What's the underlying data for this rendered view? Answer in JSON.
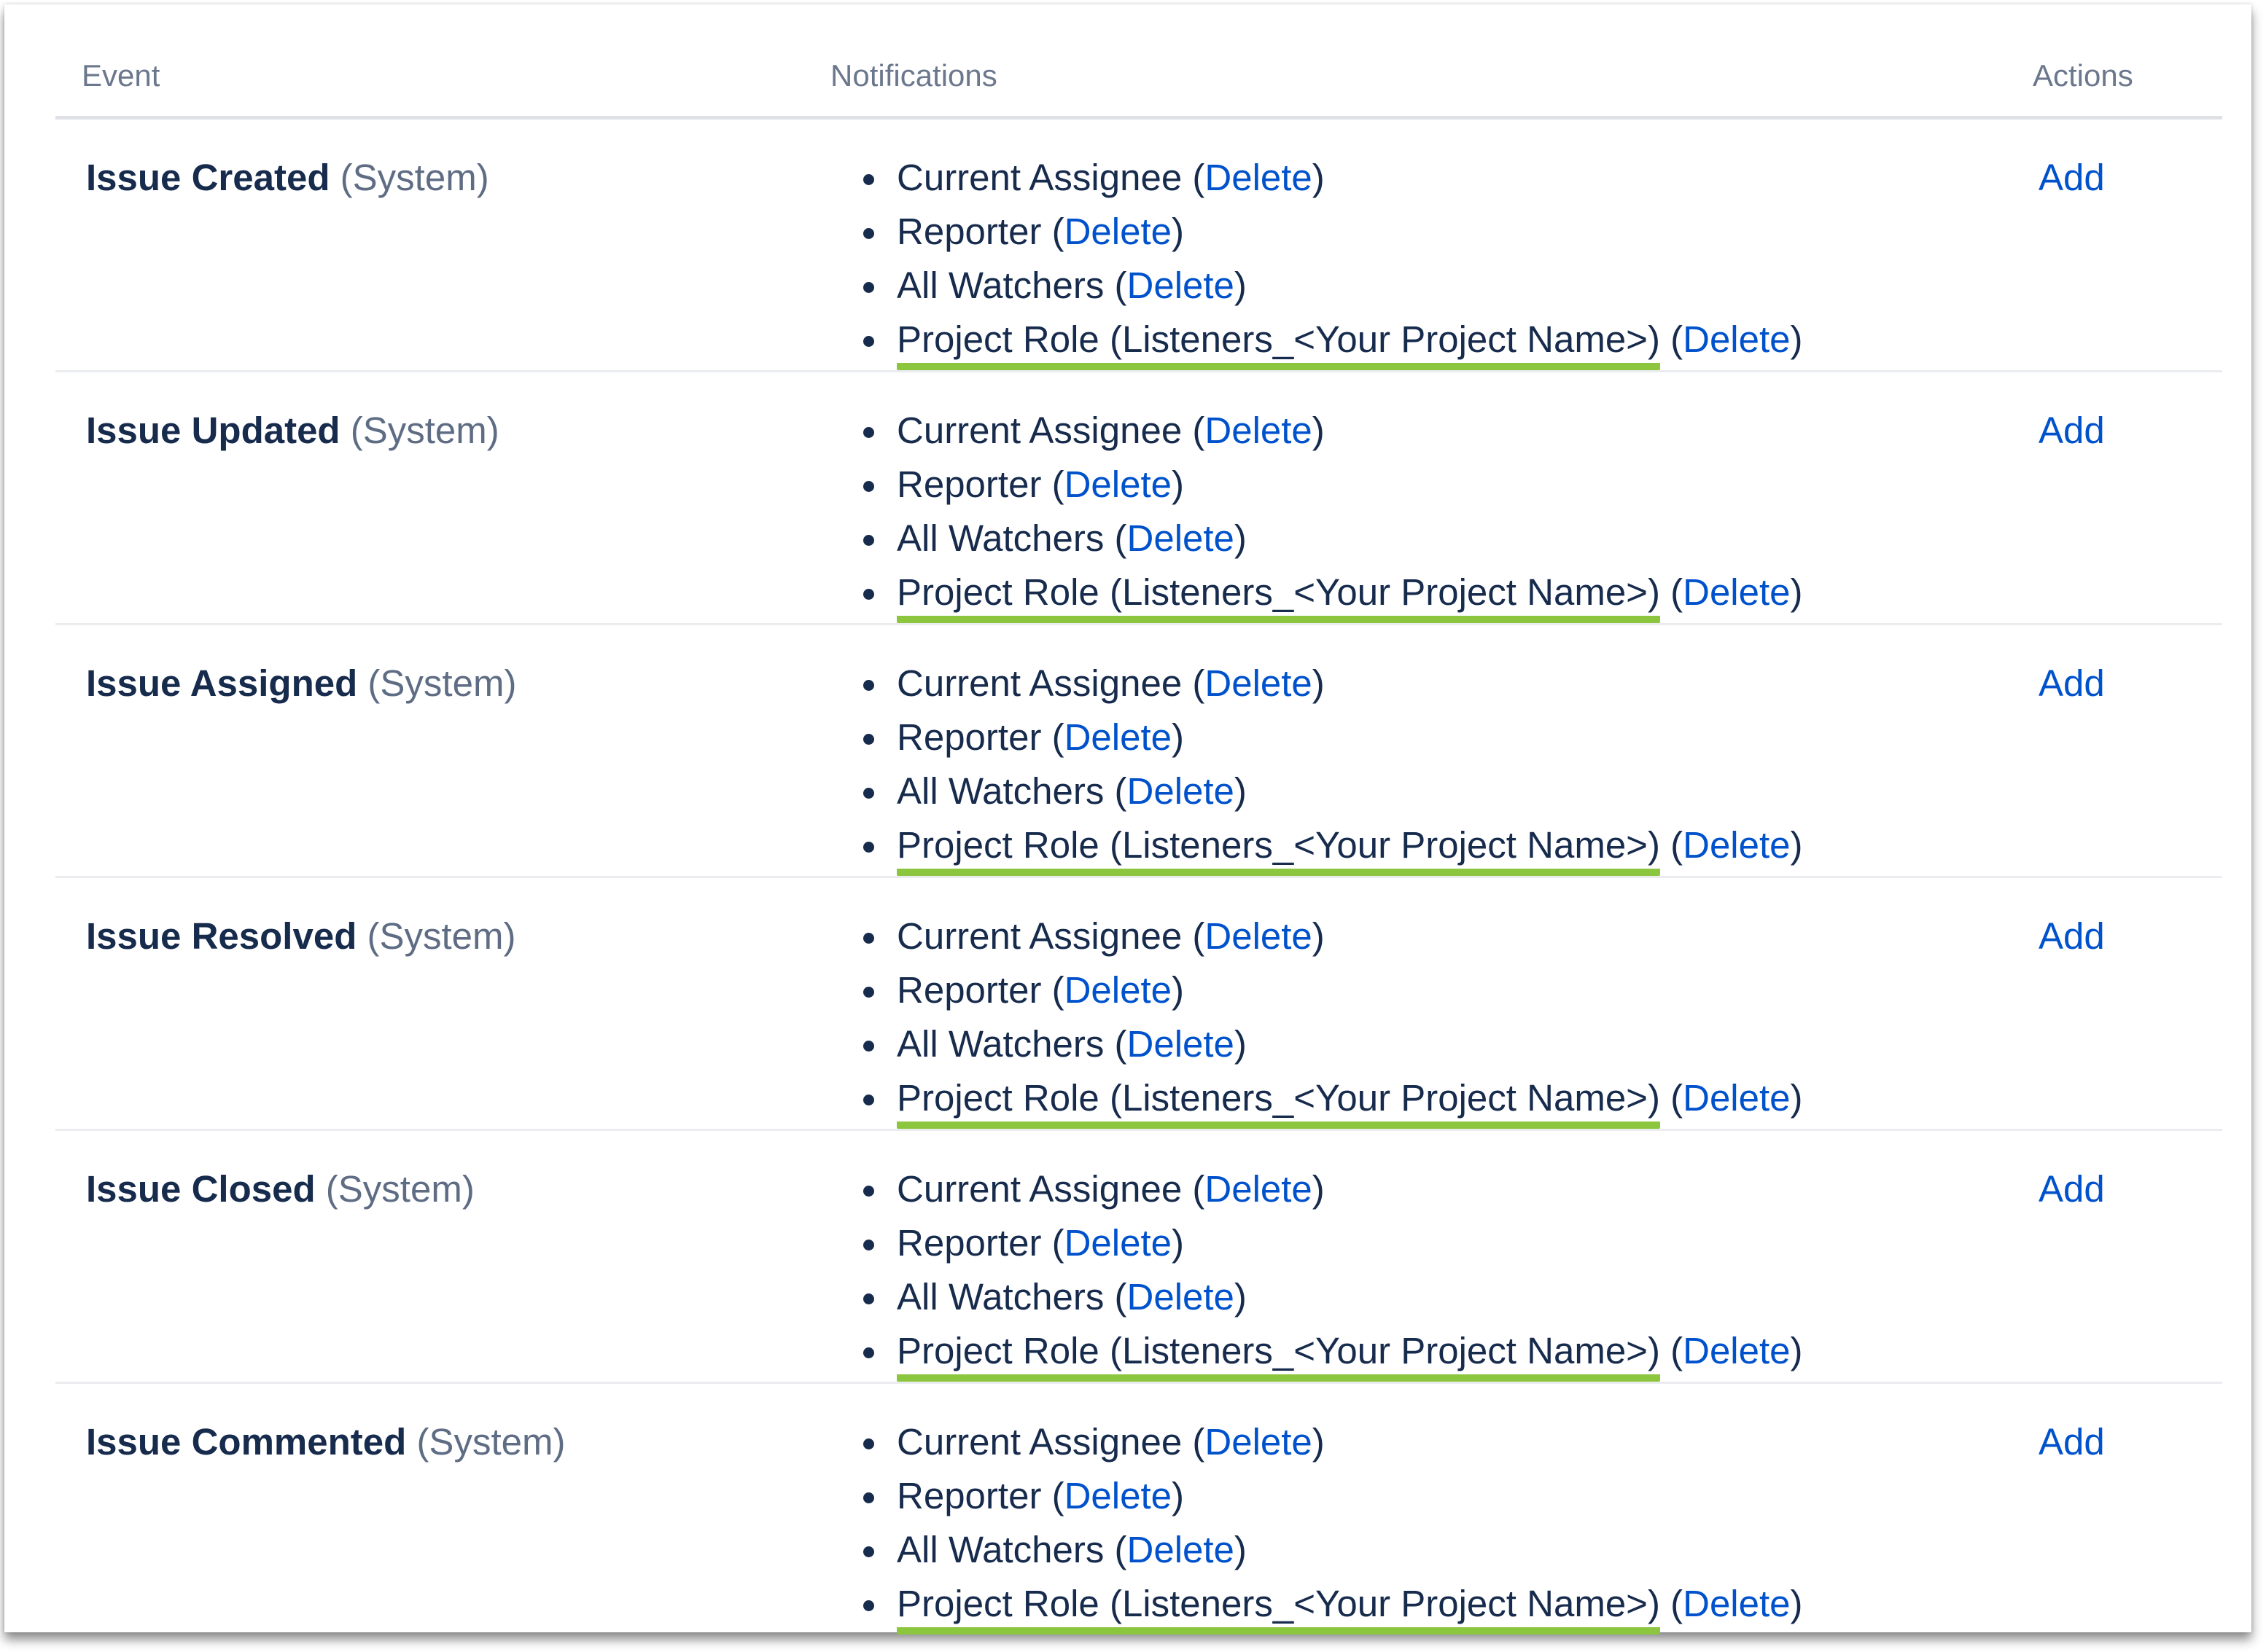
{
  "table": {
    "headers": {
      "event": "Event",
      "notifications": "Notifications",
      "actions": "Actions"
    },
    "delete_label": "Delete",
    "add_label": "Add",
    "accent_color": "#8cc63f",
    "link_color": "#0052cc",
    "rows": [
      {
        "event": "Issue Created",
        "type": "(System)",
        "notifications": [
          "Current Assignee",
          "Reporter",
          "All Watchers",
          "Project Role (Listeners_<Your Project Name>)"
        ]
      },
      {
        "event": "Issue Updated",
        "type": "(System)",
        "notifications": [
          "Current Assignee",
          "Reporter",
          "All Watchers",
          "Project Role (Listeners_<Your Project Name>)"
        ]
      },
      {
        "event": "Issue Assigned",
        "type": "(System)",
        "notifications": [
          "Current Assignee",
          "Reporter",
          "All Watchers",
          "Project Role (Listeners_<Your Project Name>)"
        ]
      },
      {
        "event": "Issue Resolved",
        "type": "(System)",
        "notifications": [
          "Current Assignee",
          "Reporter",
          "All Watchers",
          "Project Role (Listeners_<Your Project Name>)"
        ]
      },
      {
        "event": "Issue Closed",
        "type": "(System)",
        "notifications": [
          "Current Assignee",
          "Reporter",
          "All Watchers",
          "Project Role (Listeners_<Your Project Name>)"
        ]
      },
      {
        "event": "Issue Commented",
        "type": "(System)",
        "notifications": [
          "Current Assignee",
          "Reporter",
          "All Watchers",
          "Project Role (Listeners_<Your Project Name>)"
        ]
      }
    ]
  }
}
